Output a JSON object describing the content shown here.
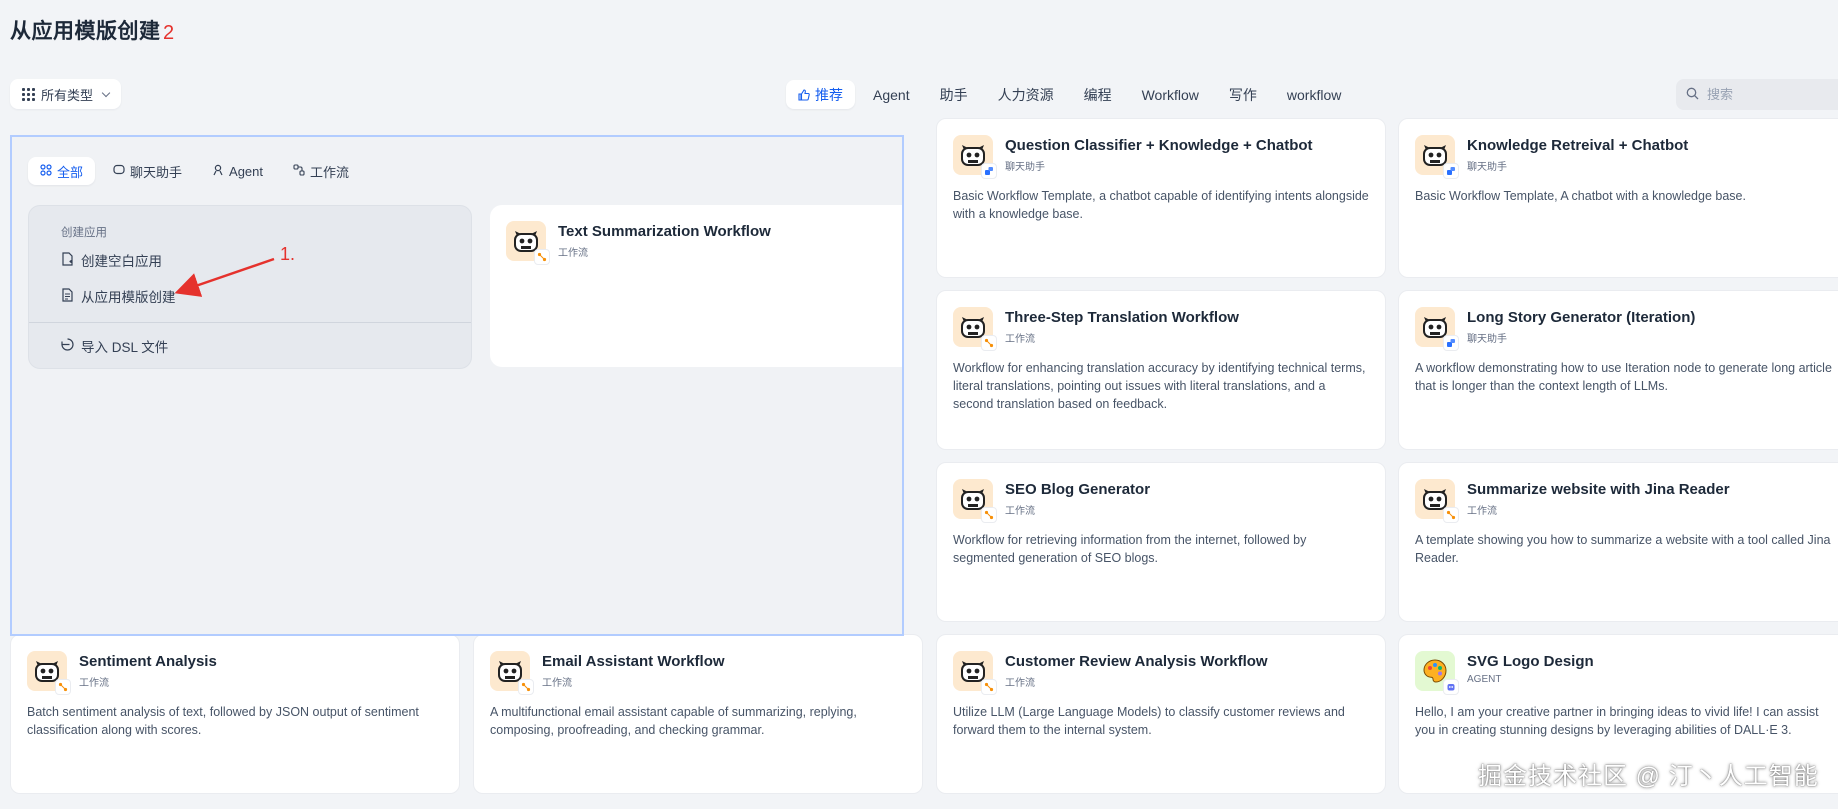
{
  "page_title": "从应用模版创建",
  "annotations": {
    "step2": "2",
    "step1": "1."
  },
  "type_select": {
    "label": "所有类型"
  },
  "tabs": [
    {
      "label": "推荐",
      "active": true
    },
    {
      "label": "Agent"
    },
    {
      "label": "助手"
    },
    {
      "label": "人力资源"
    },
    {
      "label": "编程"
    },
    {
      "label": "Workflow"
    },
    {
      "label": "写作"
    },
    {
      "label": "workflow"
    }
  ],
  "search": {
    "placeholder": "搜索"
  },
  "overlay": {
    "tabs": [
      {
        "label": "全部",
        "active": true
      },
      {
        "label": "聊天助手"
      },
      {
        "label": "Agent"
      },
      {
        "label": "工作流"
      }
    ],
    "menu": {
      "section_label": "创建应用",
      "create_blank": "创建空白应用",
      "from_template": "从应用模版创建",
      "import_dsl": "导入 DSL 文件"
    },
    "card": {
      "title": "Text Summarization Workflow",
      "type": "工作流"
    }
  },
  "cards": [
    {
      "title": "Question Classifier + Knowledge + Chatbot",
      "type": "聊天助手",
      "desc": "Basic Workflow Template, a chatbot capable of identifying intents alongside with a knowledge base."
    },
    {
      "title": "Knowledge Retreival + Chatbot",
      "type": "聊天助手",
      "desc": "Basic Workflow Template, A chatbot with a knowledge base."
    },
    {
      "title": "Three-Step Translation Workflow",
      "type": "工作流",
      "desc": "Workflow for enhancing translation accuracy by identifying technical terms, literal translations, pointing out issues with literal translations, and a second translation based on feedback."
    },
    {
      "title": "Long Story Generator (Iteration)",
      "type": "聊天助手",
      "desc": "A workflow demonstrating how to use Iteration node to generate long article that is longer than the context length of LLMs."
    },
    {
      "title": "SEO Blog Generator",
      "type": "工作流",
      "desc": "Workflow for retrieving information from the internet, followed by segmented generation of SEO blogs."
    },
    {
      "title": "Summarize website with Jina Reader",
      "type": "工作流",
      "desc": "A template showing you how to summarize a website with a tool called Jina Reader."
    },
    {
      "title": "Sentiment Analysis",
      "type": "工作流",
      "desc": "Batch sentiment analysis of text, followed by JSON output of sentiment classification along with scores."
    },
    {
      "title": "Email Assistant Workflow",
      "type": "工作流",
      "desc": "A multifunctional email assistant capable of summarizing, replying, composing, proofreading, and checking grammar."
    },
    {
      "title": "Customer Review Analysis Workflow",
      "type": "工作流",
      "desc": "Utilize LLM (Large Language Models) to classify customer reviews and forward them to the internal system."
    },
    {
      "title": "SVG Logo Design",
      "type": "AGENT",
      "desc": "Hello, I am your creative partner in bringing ideas to vivid life! I can assist you in creating stunning designs by leveraging abilities of DALL·E 3."
    }
  ],
  "watermark": "掘金技术社区 @ 汀丶人工智能",
  "colors": {
    "accent": "#155eef",
    "annotation": "#e5322d",
    "avatar_bg": "#fde9cf"
  },
  "icons": {
    "card_avatar": "robot-face-icon",
    "logo_avatar": "palette-icon"
  }
}
